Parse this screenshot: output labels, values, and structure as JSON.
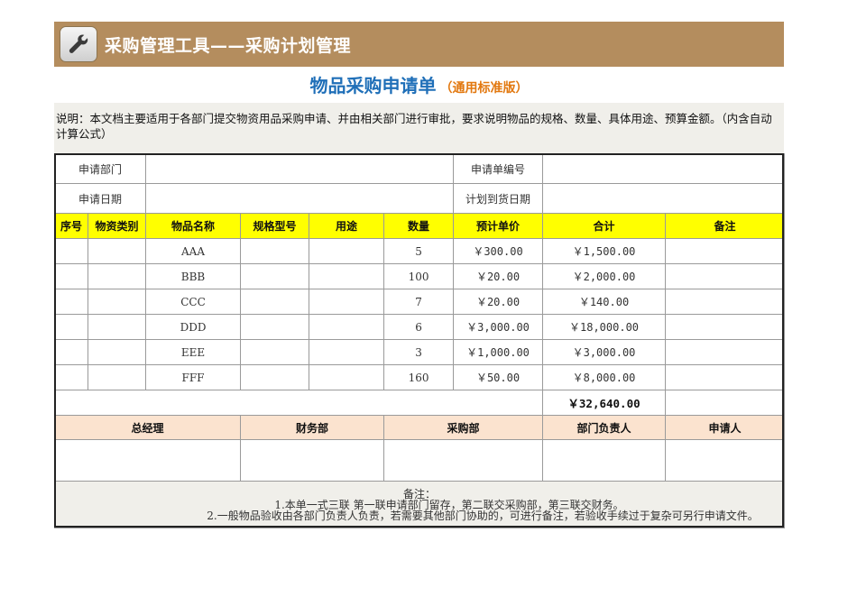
{
  "banner": {
    "title": "采购管理工具——采购计划管理",
    "icon": "wrench-icon"
  },
  "doc": {
    "title": "物品采购申请单",
    "subtitle": "（通用标准版）"
  },
  "note": {
    "text": "说明：本文档主要适用于各部门提交物资用品采购申请、并由相关部门进行审批，要求说明物品的规格、数量、具体用途、预算金额。（内含自动计算公式）"
  },
  "info": {
    "dept_label": "申请部门",
    "dept_value": "",
    "number_label": "申请单编号",
    "number_value": "",
    "date_label": "申请日期",
    "date_value": "",
    "arrival_label": "计划到货日期",
    "arrival_value": ""
  },
  "columns": [
    "序号",
    "物资类别",
    "物品名称",
    "规格型号",
    "用途",
    "数量",
    "预计单价",
    "合计",
    "备注"
  ],
  "items": [
    {
      "seq": "",
      "category": "",
      "name": "AAA",
      "spec": "",
      "use": "",
      "qty": "5",
      "price": "￥300.00",
      "total": "￥1,500.00",
      "remark": ""
    },
    {
      "seq": "",
      "category": "",
      "name": "BBB",
      "spec": "",
      "use": "",
      "qty": "100",
      "price": "￥20.00",
      "total": "￥2,000.00",
      "remark": ""
    },
    {
      "seq": "",
      "category": "",
      "name": "CCC",
      "spec": "",
      "use": "",
      "qty": "7",
      "price": "￥20.00",
      "total": "￥140.00",
      "remark": ""
    },
    {
      "seq": "",
      "category": "",
      "name": "DDD",
      "spec": "",
      "use": "",
      "qty": "6",
      "price": "￥3,000.00",
      "total": "￥18,000.00",
      "remark": ""
    },
    {
      "seq": "",
      "category": "",
      "name": "EEE",
      "spec": "",
      "use": "",
      "qty": "3",
      "price": "￥1,000.00",
      "total": "￥3,000.00",
      "remark": ""
    },
    {
      "seq": "",
      "category": "",
      "name": "FFF",
      "spec": "",
      "use": "",
      "qty": "160",
      "price": "￥50.00",
      "total": "￥8,000.00",
      "remark": ""
    }
  ],
  "grand_total": "￥32,640.00",
  "signatures": [
    "总经理",
    "财务部",
    "采购部",
    "部门负责人",
    "申请人"
  ],
  "remarks": {
    "label": "备注：",
    "line1": "1.本单一式三联 第一联申请部门留存，第二联交采购部，第三联交财务。",
    "line2": "2.一般物品验收由各部门负责人负责，若需要其他部门协助的，可进行备注，若验收手续过于复杂可另行申请文件。"
  }
}
